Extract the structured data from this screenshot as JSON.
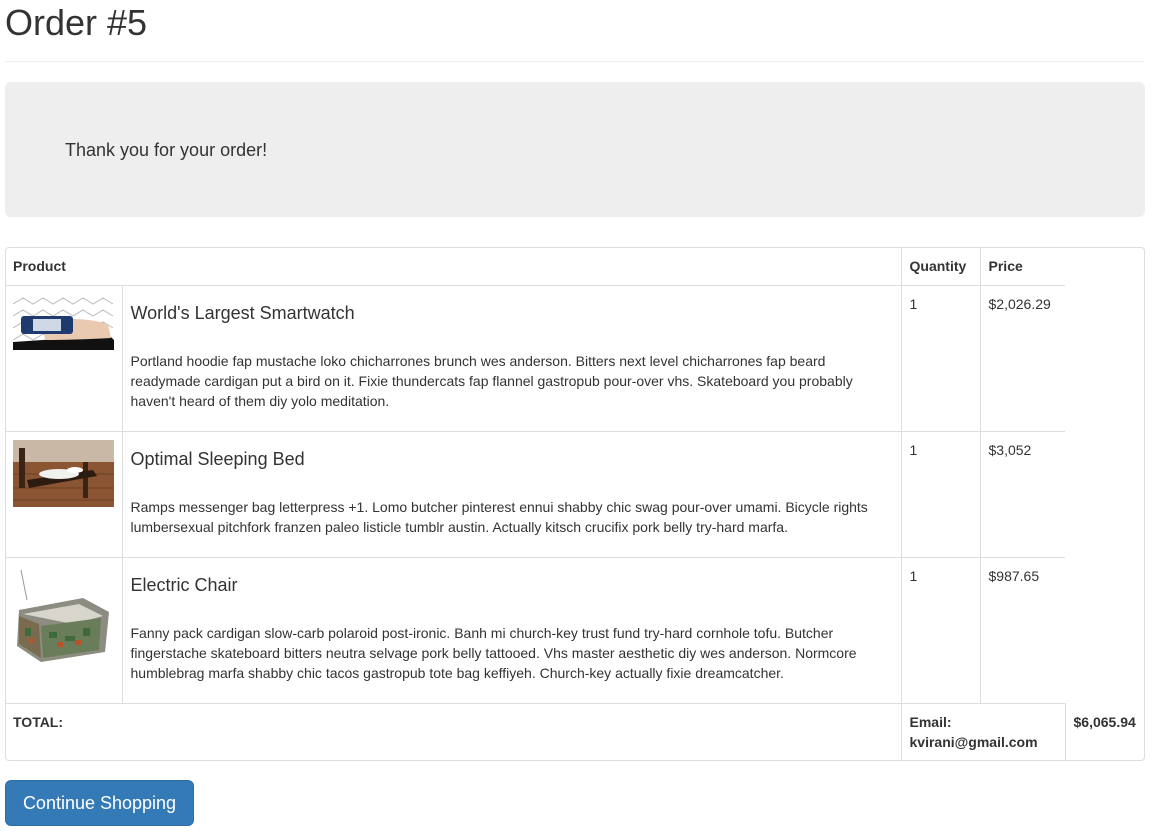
{
  "page": {
    "title": "Order #5"
  },
  "jumbotron": {
    "message": "Thank you for your order!"
  },
  "table": {
    "headers": {
      "product": "Product",
      "quantity": "Quantity",
      "price": "Price"
    },
    "items": [
      {
        "name": "World's Largest Smartwatch",
        "description": "Portland hoodie fap mustache loko chicharrones brunch wes anderson. Bitters next level chicharrones fap beard readymade cardigan put a bird on it. Fixie thundercats fap flannel gastropub pour-over vhs. Skateboard you probably haven't heard of them diy yolo meditation.",
        "quantity": "1",
        "price": "$2,026.29",
        "image": "smartwatch-photo"
      },
      {
        "name": "Optimal Sleeping Bed",
        "description": "Ramps messenger bag letterpress +1. Lomo butcher pinterest ennui shabby chic swag pour-over umami. Bicycle rights lumbersexual pitchfork franzen paleo listicle tumblr austin. Actually kitsch crucifix pork belly try-hard marfa.",
        "quantity": "1",
        "price": "$3,052",
        "image": "bed-photo"
      },
      {
        "name": "Electric Chair",
        "description": "Fanny pack cardigan slow-carb polaroid post-ironic. Banh mi church-key trust fund try-hard cornhole tofu. Butcher fingerstache skateboard bitters neutra selvage pork belly tattooed. Vhs master aesthetic diy wes anderson. Normcore humblebrag marfa shabby chic tacos gastropub tote bag keffiyeh. Church-key actually fixie dreamcatcher.",
        "quantity": "1",
        "price": "$987.65",
        "image": "chair-photo"
      }
    ],
    "footer": {
      "total_label": "TOTAL:",
      "email_label": "Email:",
      "email": "kvirani@gmail.com",
      "total": "$6,065.94"
    }
  },
  "buttons": {
    "continue_label": "Continue Shopping"
  },
  "colors": {
    "primary": "#337ab7",
    "jumbotron_bg": "#eeeeee",
    "border": "#dddddd",
    "text": "#333333"
  }
}
